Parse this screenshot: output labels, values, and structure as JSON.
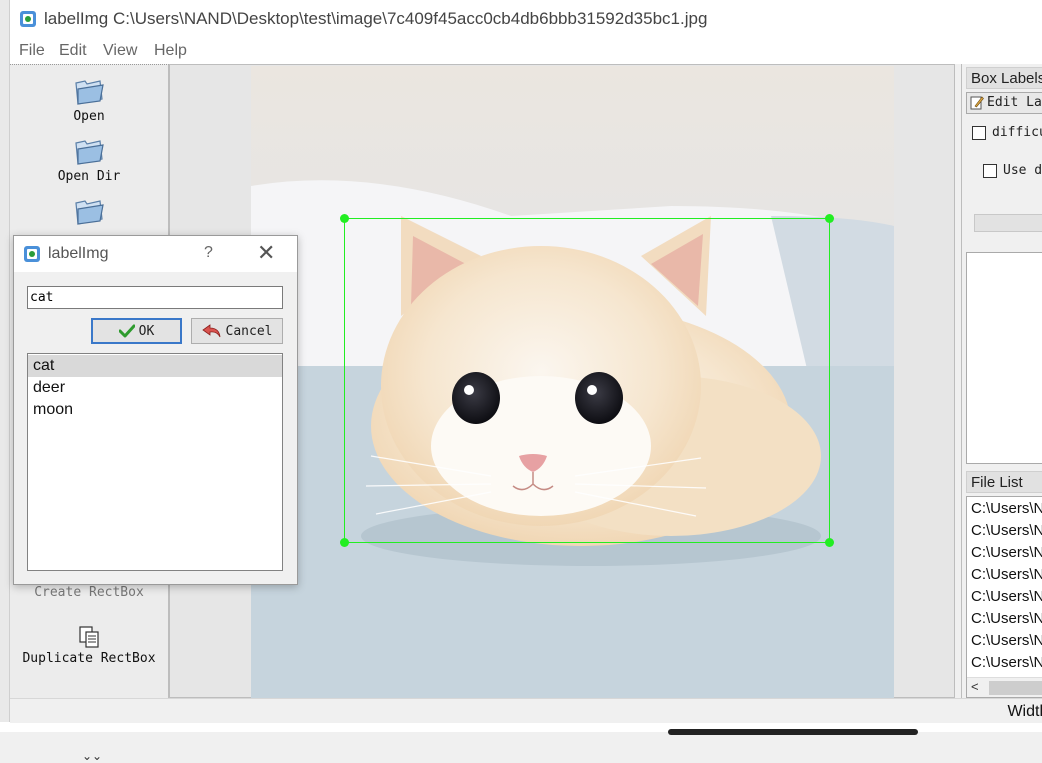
{
  "window": {
    "title": "labelImg C:\\Users\\NAND\\Desktop\\test\\image\\7c409f45acc0cb4db6bbb31592d35bc1.jpg",
    "app_icon": "labelimg-app-icon"
  },
  "menu": [
    "File",
    "Edit",
    "View",
    "Help"
  ],
  "toolbar": {
    "items": [
      {
        "label": "Open",
        "icon": "folder-icon",
        "enabled": true
      },
      {
        "label": "Open Dir",
        "icon": "folder-icon",
        "enabled": true
      },
      {
        "label": "Create RectBox",
        "icon": "rectbox-icon",
        "enabled": false
      },
      {
        "label": "Duplicate RectBox",
        "icon": "duplicate-icon",
        "enabled": true
      }
    ],
    "more_icon": "chevron-double-down-icon"
  },
  "canvas": {
    "image_subject": "cat",
    "bbox_color": "#22ee22"
  },
  "right_dock": {
    "box_labels_title": "Box Labels",
    "edit_label_button": "Edit La",
    "difficult_label": "difficul",
    "difficult_checked": false,
    "use_default_label": "Use de",
    "use_default_checked": false,
    "file_list_title": "File List",
    "file_list": [
      "C:\\Users\\N",
      "C:\\Users\\N",
      "C:\\Users\\N",
      "C:\\Users\\N",
      "C:\\Users\\N",
      "C:\\Users\\N",
      "C:\\Users\\N",
      "C:\\Users\\N"
    ]
  },
  "statusbar": {
    "text": "Widtl"
  },
  "dialog": {
    "title": "labelImg",
    "help": "?",
    "close": "✕",
    "input_value": "cat",
    "ok_label": "OK",
    "cancel_label": "Cancel",
    "labels": [
      "cat",
      "deer",
      "moon"
    ],
    "selected_label": "cat"
  }
}
